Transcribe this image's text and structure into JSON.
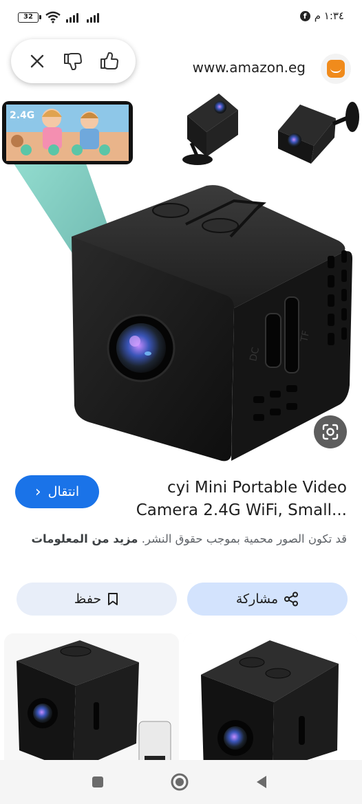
{
  "status_bar": {
    "battery": "32",
    "time": "١:٣٤ م",
    "facebook_notification": "f"
  },
  "feedback": {
    "close_label": "close",
    "dislike_label": "thumbs down",
    "like_label": "thumbs up"
  },
  "source": {
    "url": "www.amazon.eg",
    "brand_color": "#f08b1c"
  },
  "product": {
    "title_line1": "cyi Mini Portable Video",
    "title_line2": "Camera 2.4G WiFi, Small...",
    "visit_label": "انتقال",
    "visit_chevron": "‹",
    "copyright_notice": "قد تكون الصور محمية بموجب حقوق النشر.",
    "more_info_label": "مزيد من المعلومات"
  },
  "phone_overlay": {
    "badge": "2.4G"
  },
  "camera_markings": {
    "dc": "DC",
    "tf": "TF"
  },
  "actions": {
    "share_label": "مشاركة",
    "save_label": "حفظ"
  },
  "colors": {
    "accent_blue": "#1a73e8",
    "share_bg": "#d3e3fd",
    "save_bg": "#e8eef9"
  }
}
